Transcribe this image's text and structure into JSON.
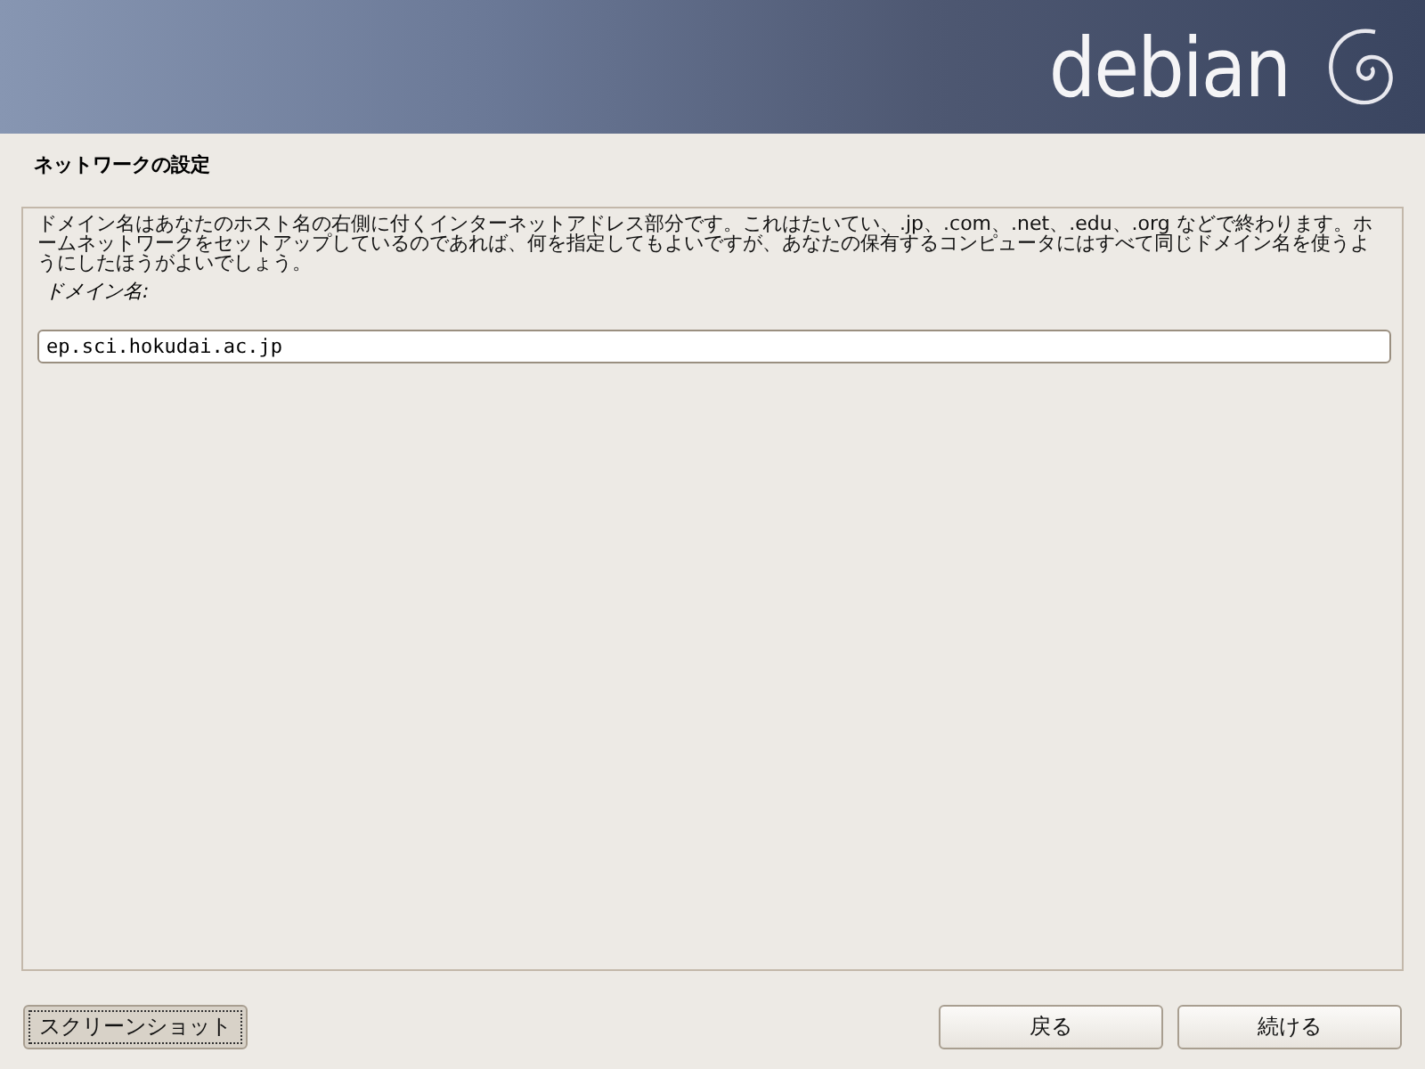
{
  "banner": {
    "logo_text": "debian"
  },
  "title": "ネットワークの設定",
  "description": "ドメイン名はあなたのホスト名の右側に付くインターネットアドレス部分です。これはたいてい、.jp、.com、.net、.edu、.org などで終わります。ホームネットワークをセットアップしているのであれば、何を指定してもよいですが、あなたの保有するコンピュータにはすべて同じドメイン名を使うようにしたほうがよいでしょう。",
  "field": {
    "label": "ドメイン名:",
    "value": "ep.sci.hokudai.ac.jp"
  },
  "buttons": [
    {
      "label": "スクリーンショット",
      "kind": "left",
      "focused": true
    },
    {
      "label": "戻る",
      "kind": "right",
      "focused": false
    },
    {
      "label": "続ける",
      "kind": "right",
      "focused": false
    }
  ]
}
